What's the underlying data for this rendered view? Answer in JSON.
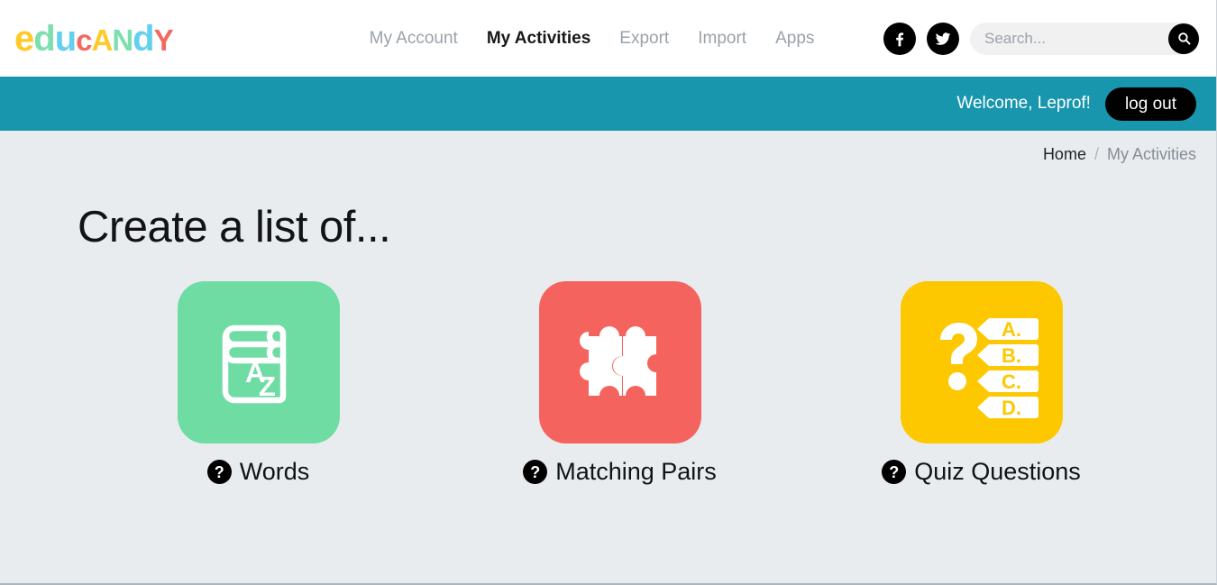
{
  "brand": {
    "name": "educandy",
    "letters": [
      {
        "ch": "e",
        "color": "#ffc928"
      },
      {
        "ch": "d",
        "color": "#7ddeae"
      },
      {
        "ch": "u",
        "color": "#64cfee"
      },
      {
        "ch": "c",
        "color": "#f4695f"
      },
      {
        "ch": "A",
        "color": "#ffc928"
      },
      {
        "ch": "N",
        "color": "#7ddeae"
      },
      {
        "ch": "d",
        "color": "#64cfee"
      },
      {
        "ch": "Y",
        "color": "#f4695f"
      }
    ]
  },
  "nav": {
    "items": [
      {
        "label": "My Account",
        "active": false
      },
      {
        "label": "My Activities",
        "active": true
      },
      {
        "label": "Export",
        "active": false
      },
      {
        "label": "Import",
        "active": false
      },
      {
        "label": "Apps",
        "active": false
      }
    ]
  },
  "social": {
    "facebook_icon": "facebook-icon",
    "twitter_icon": "twitter-icon"
  },
  "search": {
    "placeholder": "Search...",
    "value": "",
    "button_icon": "search-icon"
  },
  "userbar": {
    "welcome": "Welcome, Leprof!",
    "logout_label": "log out",
    "background": "#1796ae"
  },
  "breadcrumb": {
    "home": "Home",
    "separator": "/",
    "current": "My Activities"
  },
  "main": {
    "title": "Create a list of...",
    "tiles": [
      {
        "label": "Words",
        "icon": "dictionary-book-icon",
        "color": "#6fdca4",
        "book_letters": {
          "top": "A",
          "bottom": "Z"
        },
        "help_icon": "question-mark-icon"
      },
      {
        "label": "Matching Pairs",
        "icon": "puzzle-pieces-icon",
        "color": "#f4635e",
        "help_icon": "question-mark-icon"
      },
      {
        "label": "Quiz Questions",
        "icon": "quiz-choices-icon",
        "color": "#fdc800",
        "choices": [
          "A.",
          "B.",
          "C.",
          "D."
        ],
        "help_icon": "question-mark-icon"
      }
    ]
  },
  "colors": {
    "page_background": "#e9ecef",
    "header_background": "#ffffff",
    "teal_bar": "#1796ae",
    "accent_black": "#000000"
  }
}
